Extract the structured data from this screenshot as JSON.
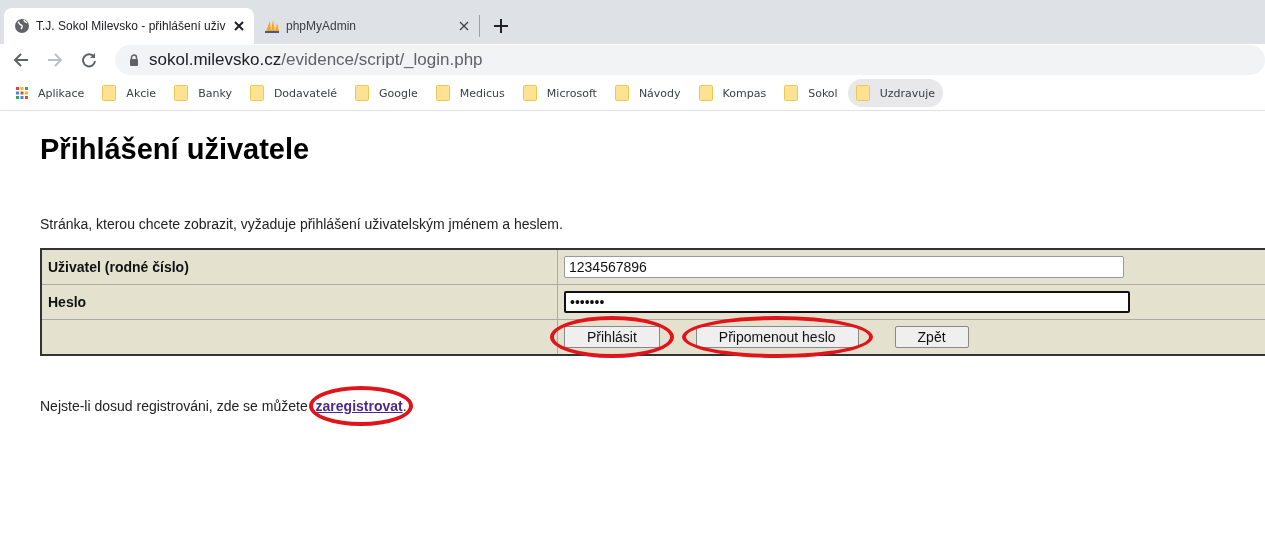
{
  "browser": {
    "tabs": [
      {
        "title": "T.J. Sokol Milevsko - přihlášení uživ",
        "selected": true,
        "kind": "globe"
      },
      {
        "title": "phpMyAdmin",
        "selected": false,
        "kind": "pma"
      }
    ],
    "url_host": "sokol.milevsko.cz",
    "url_path": "/evidence/script/_login.php",
    "bookmarks": [
      {
        "label": "Aplikace",
        "kind": "apps",
        "selected": false
      },
      {
        "label": "Akcie",
        "kind": "folder",
        "selected": false
      },
      {
        "label": "Banky",
        "kind": "folder",
        "selected": false
      },
      {
        "label": "Dodavatelé",
        "kind": "folder",
        "selected": false
      },
      {
        "label": "Google",
        "kind": "folder",
        "selected": false
      },
      {
        "label": "Medicus",
        "kind": "folder",
        "selected": false
      },
      {
        "label": "Microsoft",
        "kind": "folder",
        "selected": false
      },
      {
        "label": "Návody",
        "kind": "folder",
        "selected": false
      },
      {
        "label": "Kompas",
        "kind": "folder",
        "selected": false
      },
      {
        "label": "Sokol",
        "kind": "folder",
        "selected": false
      },
      {
        "label": "Uzdravuje",
        "kind": "folder",
        "selected": true
      }
    ]
  },
  "page": {
    "heading": "Přihlášení uživatele",
    "intro": "Stránka, kterou chcete zobrazit, vyžaduje přihlášení uživatelským jménem a heslem.",
    "fields": [
      {
        "label": "Uživatel (rodné číslo)",
        "value": "1234567896",
        "focused": false
      },
      {
        "label": "Heslo",
        "value": "•••••••",
        "focused": true
      }
    ],
    "buttons": [
      {
        "label": "Přihlásit",
        "highlighted": true
      },
      {
        "label": "Připomenout heslo",
        "highlighted": true
      },
      {
        "label": "Zpět",
        "highlighted": false
      }
    ],
    "note": "Nejste-li dosud registrováni, zde se můžete",
    "link": {
      "label": "zaregistrovat",
      "highlighted": true
    },
    "note_end": "."
  }
}
